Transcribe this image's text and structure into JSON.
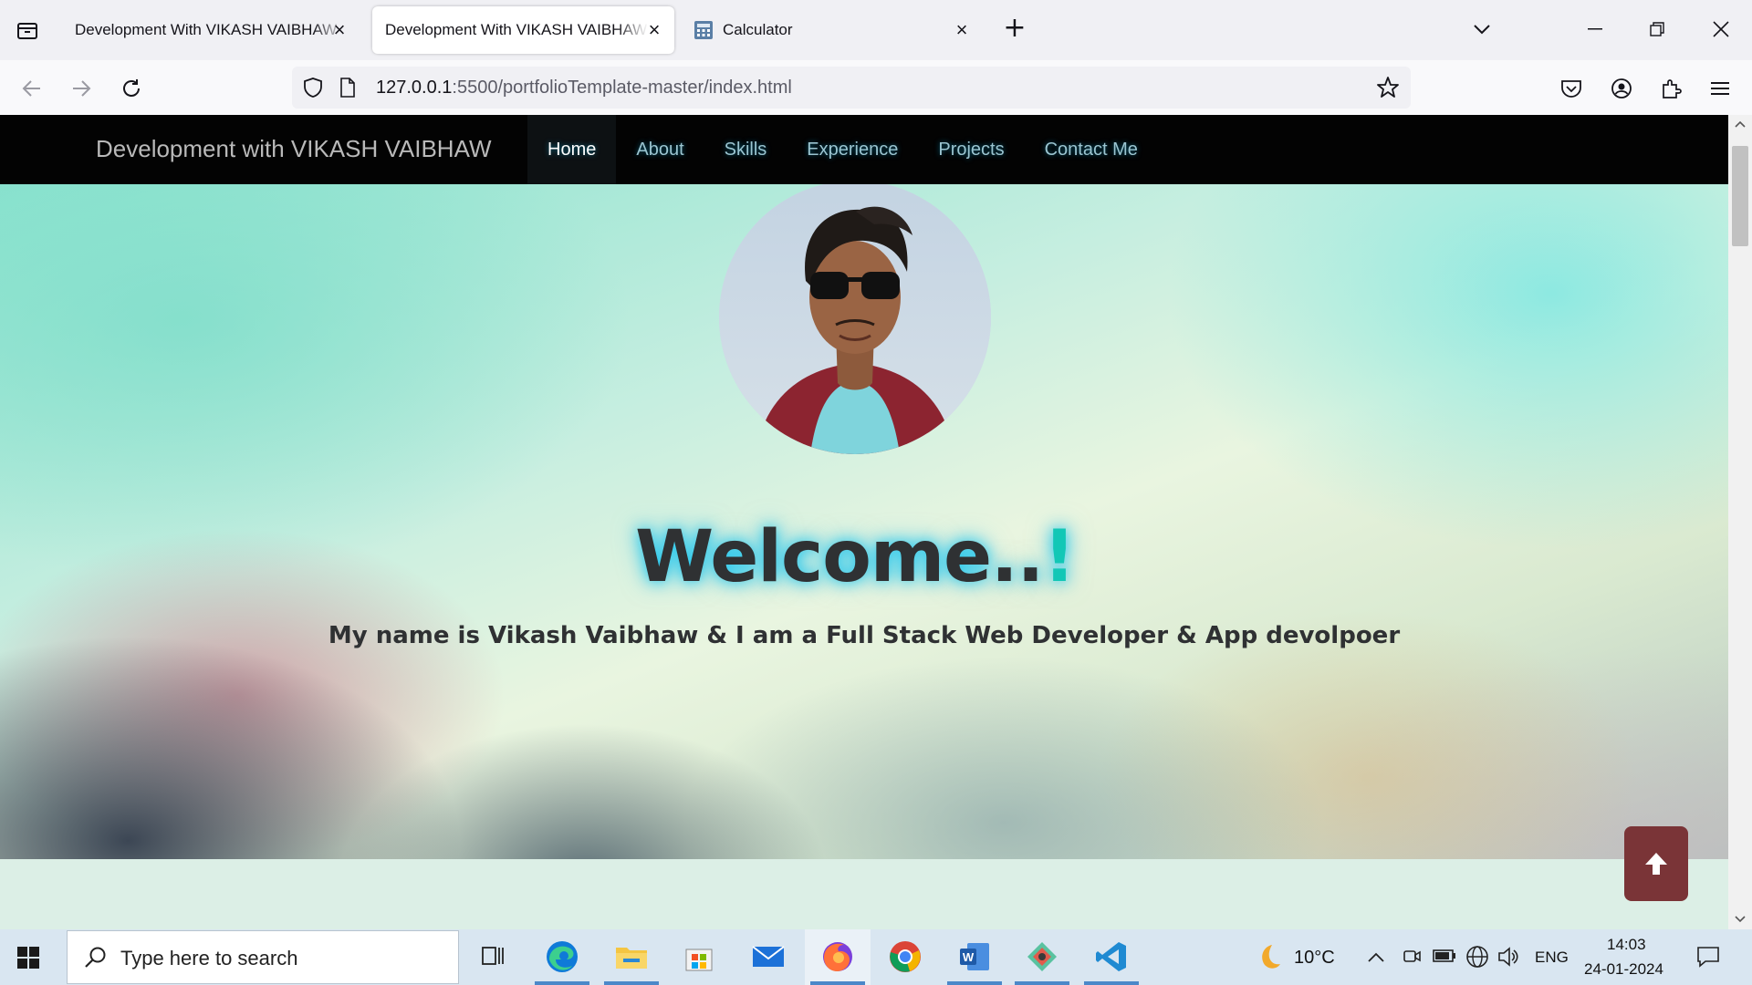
{
  "browser": {
    "tabs": [
      {
        "title": "Development With VIKASH VAIBHAW",
        "active": false
      },
      {
        "title": "Development With VIKASH VAIBHAW",
        "active": true
      },
      {
        "title": "Calculator",
        "active": false
      }
    ],
    "url_host": "127.0.0.1",
    "url_rest": ":5500/portfolioTemplate-master/index.html"
  },
  "site": {
    "brand": "Development with VIKASH VAIBHAW",
    "menu": [
      "Home",
      "About",
      "Skills",
      "Experience",
      "Projects",
      "Contact Me"
    ],
    "active_menu": "Home",
    "welcome_text": "Welcome..",
    "welcome_excl": "!",
    "tagline": "My name is Vikash Vaibhaw & I am a Full Stack Web Developer & App devolpoer"
  },
  "taskbar": {
    "search_placeholder": "Type here to search",
    "weather": "10°C",
    "language": "ENG",
    "time": "14:03",
    "date": "24-01-2024"
  },
  "colors": {
    "accent_glow": "#00bef0",
    "exclamation": "#12c7b6",
    "scroll_top_button": "#7a3437",
    "nav_background": "#030303"
  }
}
